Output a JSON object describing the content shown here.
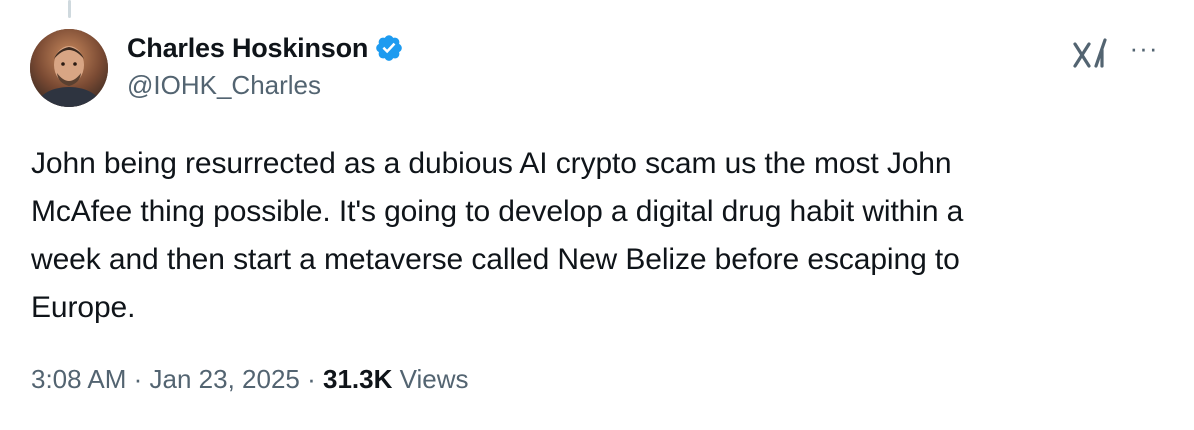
{
  "author": {
    "display_name": "Charles Hoskinson",
    "handle": "@IOHK_Charles",
    "verified_icon": "verified-badge-icon"
  },
  "actions": {
    "grok_icon": "grok-icon",
    "more_label": "···"
  },
  "tweet": {
    "text": "John being resurrected as a dubious AI crypto scam us the most John\nMcAfee thing possible. It's going to develop a digital drug habit within a\nweek and then start a metaverse called New Belize before escaping to\nEurope."
  },
  "meta": {
    "time": "3:08 AM",
    "separator": " · ",
    "date": "Jan 23, 2025",
    "views_count": "31.3K",
    "views_label": "Views"
  },
  "colors": {
    "text": "#0f1419",
    "secondary": "#536471",
    "verified": "#1d9bf0",
    "thread_line": "#cfd9de"
  }
}
